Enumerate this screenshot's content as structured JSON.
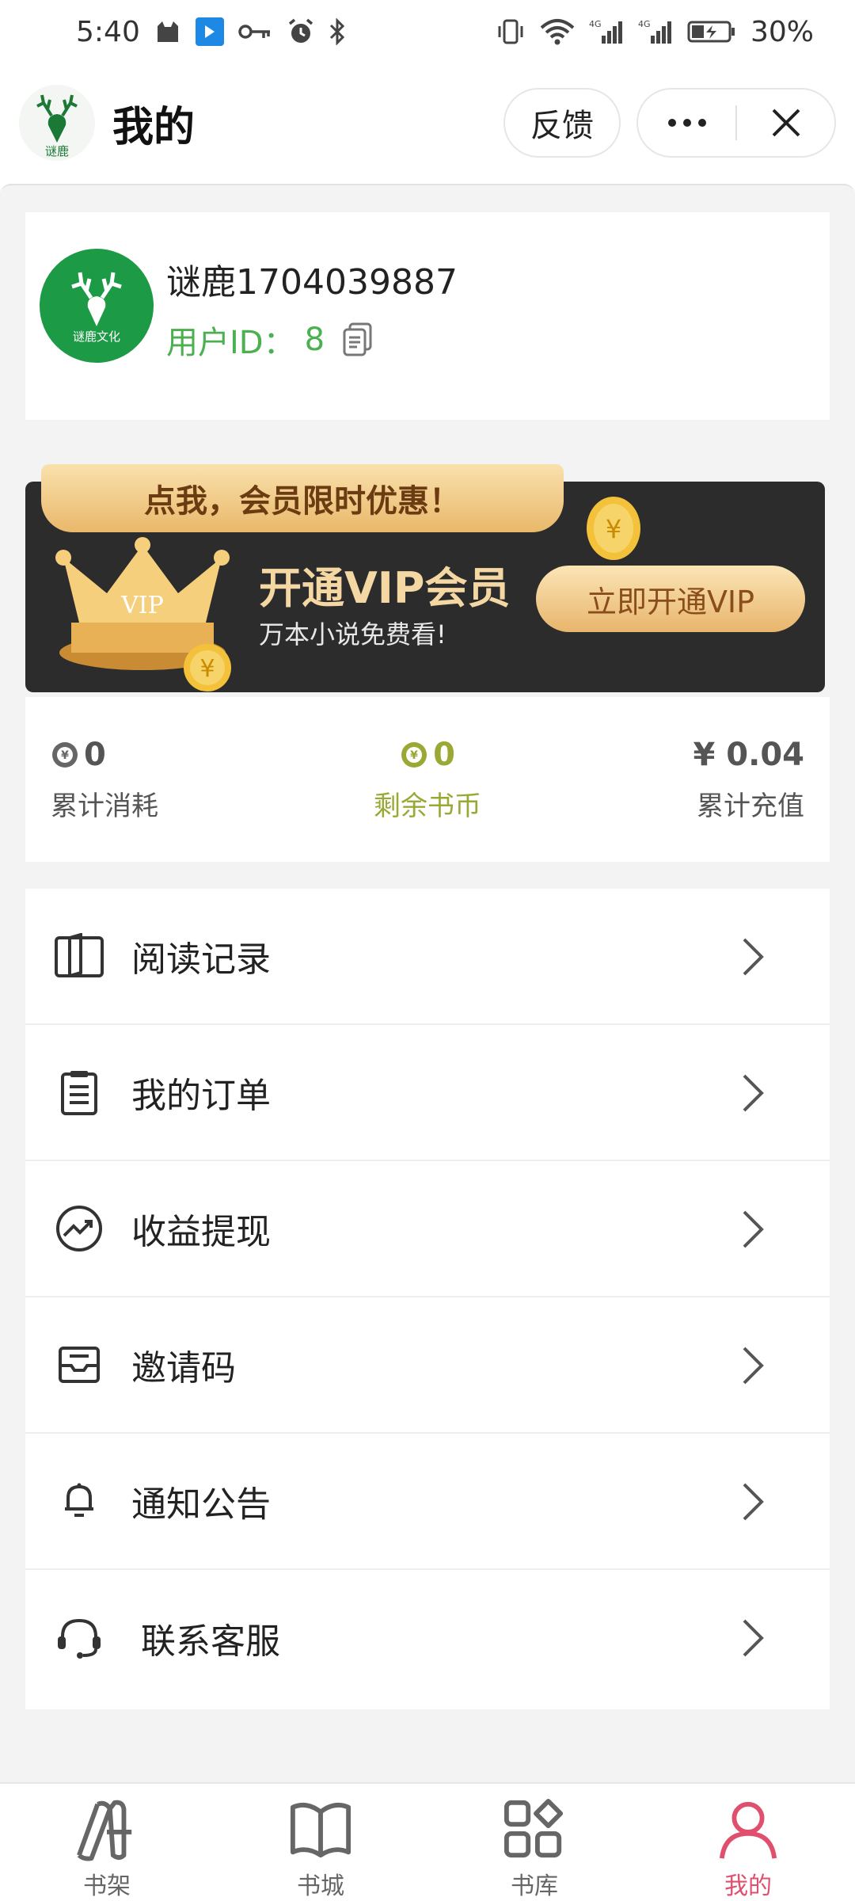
{
  "status_bar": {
    "time": "5:40",
    "battery": "30%",
    "network_1": "4G",
    "network_2": "4G"
  },
  "header": {
    "title": "我的",
    "feedback_label": "反馈",
    "more_icon": "more-dots-icon",
    "close_icon": "close-icon"
  },
  "logo": {
    "text": "谜鹿"
  },
  "profile": {
    "username": "谜鹿1704039887",
    "user_id_label": "用户ID：",
    "user_id": "8",
    "avatar_text": "谜鹿文化"
  },
  "vip": {
    "ribbon": "点我，会员限时优惠！",
    "title": "开通VIP会员",
    "subtitle": "万本小说免费看!",
    "button": "立即开通VIP",
    "crown_text": "VIP"
  },
  "stats": [
    {
      "value": "0",
      "label": "累计消耗",
      "icon": "coin-icon"
    },
    {
      "value": "0",
      "label": "剩余书币",
      "icon": "coin-icon"
    },
    {
      "value": "¥ 0.04",
      "label": "累计充值"
    }
  ],
  "menu": [
    {
      "label": "阅读记录",
      "icon": "book-icon"
    },
    {
      "label": "我的订单",
      "icon": "clipboard-icon"
    },
    {
      "label": "收益提现",
      "icon": "trend-icon"
    },
    {
      "label": "邀请码",
      "icon": "inbox-icon"
    },
    {
      "label": "通知公告",
      "icon": "bell-icon"
    },
    {
      "label": "联系客服",
      "icon": "headset-icon"
    }
  ],
  "tabs": [
    {
      "label": "书架",
      "icon": "bookshelf-icon",
      "active": false
    },
    {
      "label": "书城",
      "icon": "open-book-icon",
      "active": false
    },
    {
      "label": "书库",
      "icon": "grid-icon",
      "active": false
    },
    {
      "label": "我的",
      "icon": "person-icon",
      "active": true
    }
  ],
  "colors": {
    "accent_green": "#4caf50",
    "avatar_green": "#1c9a45",
    "coin_olive": "#9aa834",
    "tab_active": "#e0506e",
    "vip_gold": "#f4d7a3",
    "vip_dark": "#2c2c2c"
  }
}
